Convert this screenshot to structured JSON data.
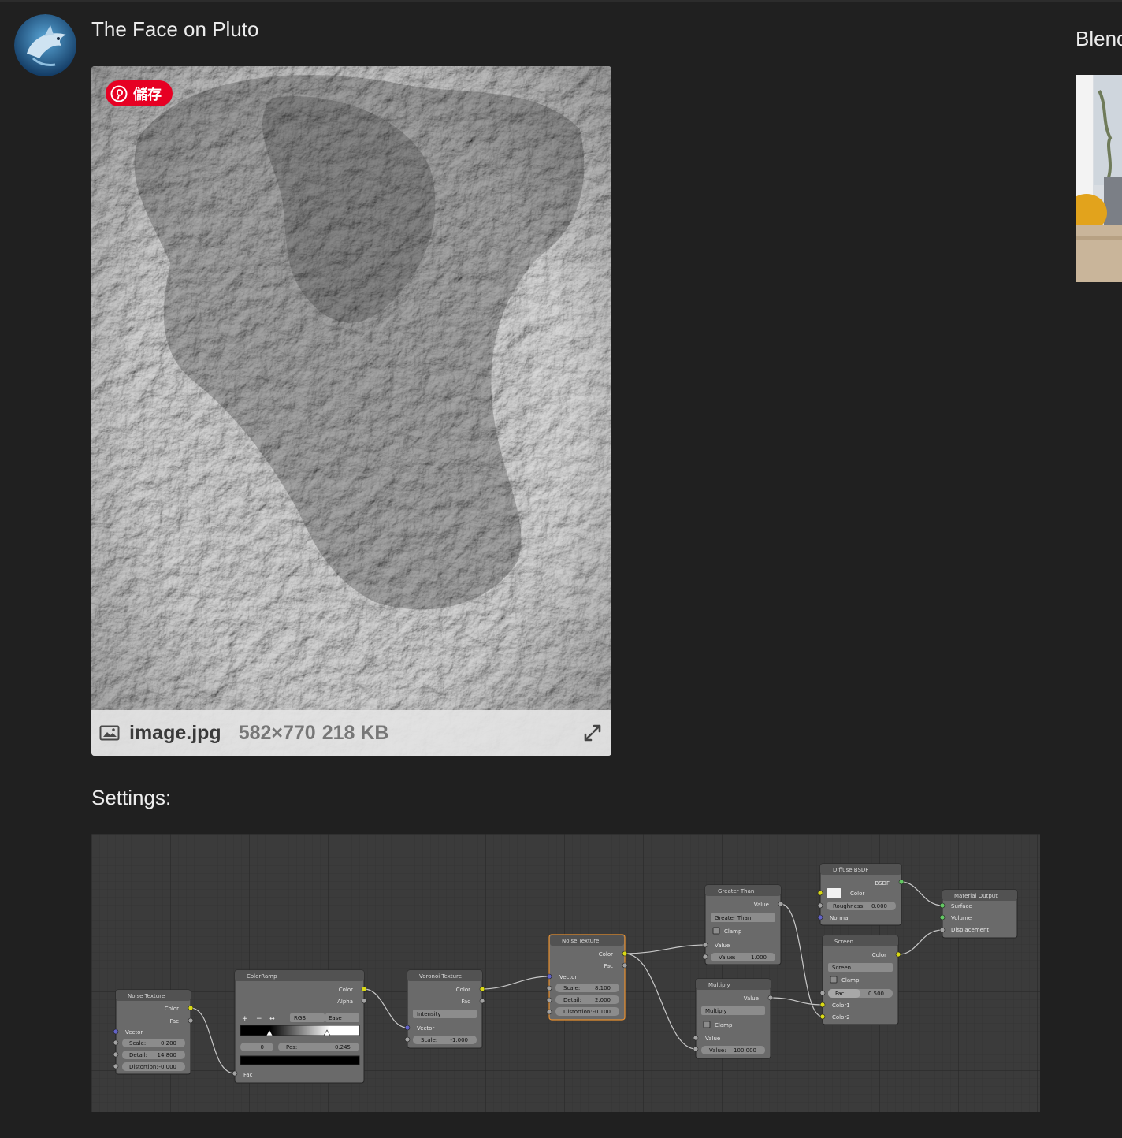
{
  "post": {
    "title": "The Face on Pluto",
    "avatar_icon": "dolphin-avatar-icon"
  },
  "attachment": {
    "pin_label": "儲存",
    "pin_icon": "pinterest-icon",
    "file_name": "image.jpg",
    "dimensions": "582×770",
    "size": "218 KB",
    "file_icon": "image-file-icon",
    "expand_icon": "expand-icon"
  },
  "settings_label": "Settings:",
  "sidebar": {
    "title": "Blenc"
  },
  "colors": {
    "page_bg": "#202020",
    "pinterest_red": "#e60023",
    "socket_yellow": "#d9d916",
    "socket_gray": "#a3a3a3",
    "socket_purple": "#6363c7",
    "socket_green": "#63c763"
  },
  "nodes": {
    "noise1": {
      "title": "Noise Texture",
      "out_color": "Color",
      "out_fac": "Fac",
      "in_vector": "Vector",
      "scale_label": "Scale:",
      "scale_value": "0.200",
      "detail_label": "Detail:",
      "detail_value": "14.800",
      "distortion_label": "Distortion:",
      "distortion_value": "-0.000"
    },
    "colorramp": {
      "title": "ColorRamp",
      "out_color": "Color",
      "out_alpha": "Alpha",
      "mode": "RGB",
      "interp": "Ease",
      "index": "0",
      "pos_label": "Pos:",
      "pos_value": "0.245",
      "in_fac": "Fac"
    },
    "voronoi": {
      "title": "Voronoi Texture",
      "out_color": "Color",
      "out_fac": "Fac",
      "coloring": "Intensity",
      "in_vector": "Vector",
      "scale_label": "Scale:",
      "scale_value": "-1.000"
    },
    "noise2": {
      "title": "Noise Texture",
      "out_color": "Color",
      "out_fac": "Fac",
      "in_vector": "Vector",
      "scale_label": "Scale:",
      "scale_value": "8.100",
      "detail_label": "Detail:",
      "detail_value": "2.000",
      "distortion_label": "Distortion:",
      "distortion_value": "-0.100"
    },
    "greater": {
      "title": "Greater Than",
      "out_value": "Value",
      "operation": "Greater Than",
      "clamp": "Clamp",
      "in_value": "Value",
      "value_label": "Value:",
      "value_value": "1.000"
    },
    "multiply": {
      "title": "Multiply",
      "out_value": "Value",
      "operation": "Multiply",
      "clamp": "Clamp",
      "in_value": "Value",
      "value_label": "Value:",
      "value_value": "100.000"
    },
    "diffuse": {
      "title": "Diffuse BSDF",
      "out_bsdf": "BSDF",
      "color_label": "Color",
      "roughness_label": "Roughness:",
      "roughness_value": "0.000",
      "normal_label": "Normal"
    },
    "screen": {
      "title": "Screen",
      "out_color": "Color",
      "blend": "Screen",
      "clamp": "Clamp",
      "fac_label": "Fac:",
      "fac_value": "0.500",
      "color1": "Color1",
      "color2": "Color2"
    },
    "output": {
      "title": "Material Output",
      "surface": "Surface",
      "volume": "Volume",
      "displacement": "Displacement"
    }
  }
}
